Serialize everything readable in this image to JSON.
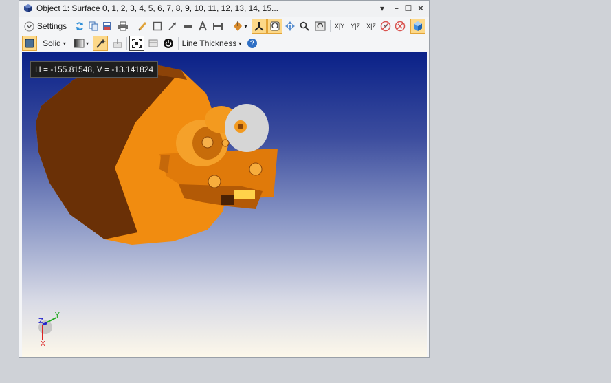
{
  "window": {
    "title": "Object 1: Surface 0, 1, 2, 3, 4, 5, 6, 7, 8, 9, 10, 11, 12, 13, 14, 15...",
    "controls": [
      "chevron-down",
      "minimize",
      "maximize",
      "close"
    ]
  },
  "toolbar1": {
    "settings_label": "Settings",
    "axis_labels": {
      "xy": "X|Y",
      "yz": "Y|Z",
      "xz": "X|Z"
    }
  },
  "toolbar2": {
    "render_mode": "Solid",
    "line_thickness_label": "Line Thickness",
    "help_label": "?"
  },
  "viewport": {
    "coord_readout": "H = -155.81548, V = -13.141824",
    "axis_triad": {
      "y": "Y",
      "z": "Z",
      "x": "X"
    }
  },
  "colors": {
    "accent_active": "#fcd889",
    "model_orange": "#f18c10",
    "model_shadow": "#7a3a00",
    "bg_top": "#0a2188",
    "bg_bottom": "#fdf8ea"
  }
}
